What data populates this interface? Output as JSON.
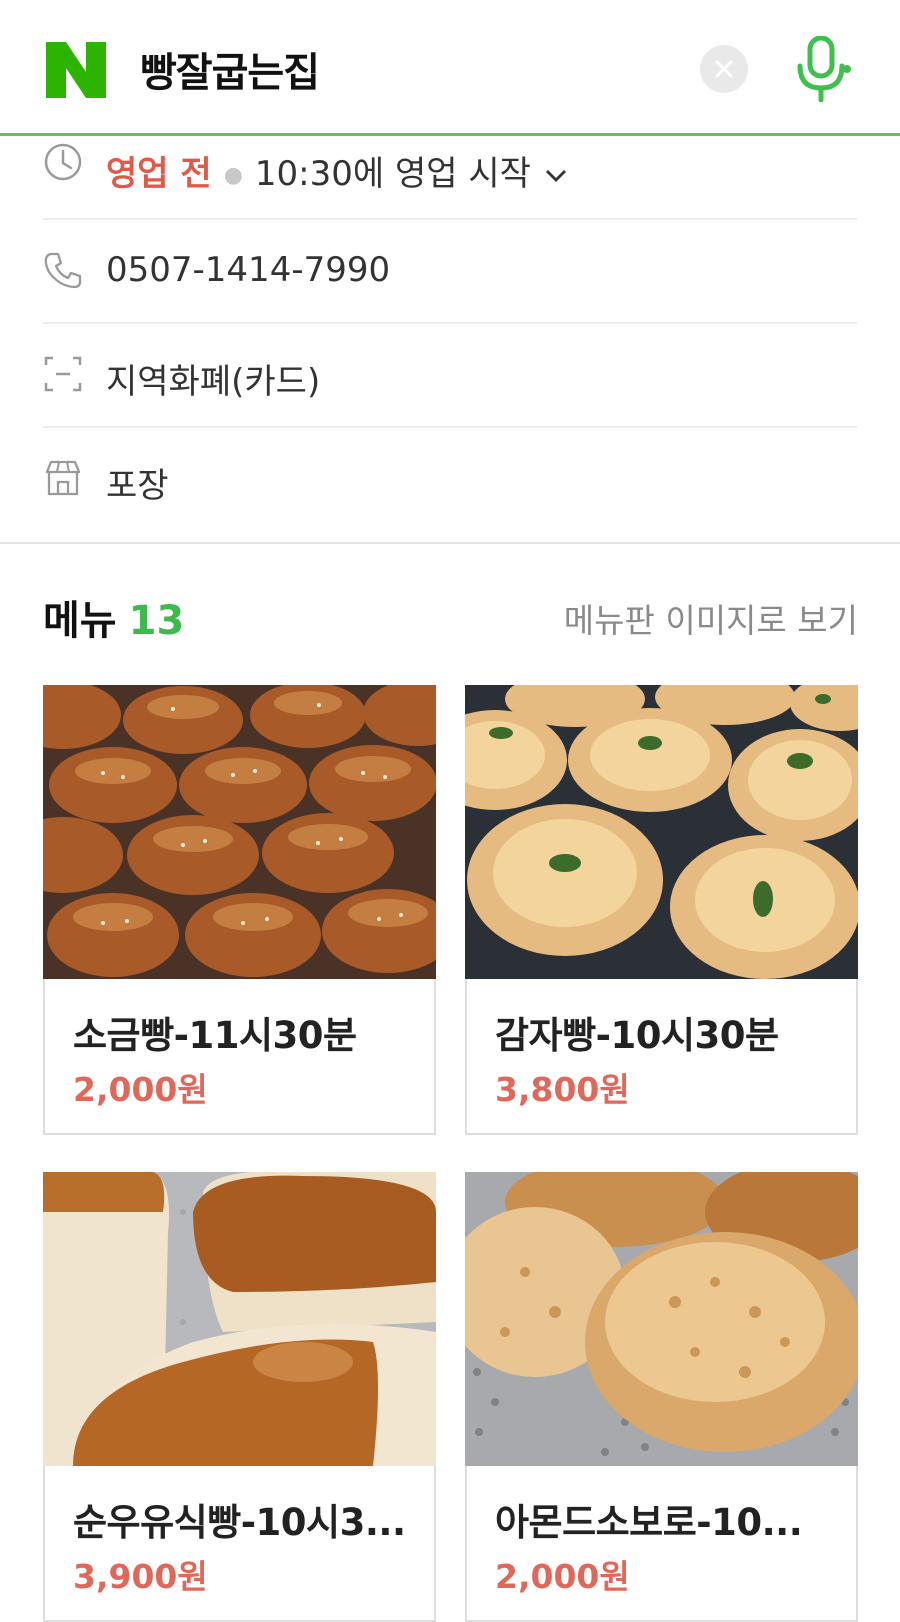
{
  "header": {
    "logo_letter": "N",
    "title": "빵잘굽는집"
  },
  "info": {
    "status": "영업 전",
    "hours": "10:30에 영업 시작",
    "phone": "0507-1414-7990",
    "payment": "지역화폐(카드)",
    "service": "포장"
  },
  "menu": {
    "title": "메뉴",
    "count": "13",
    "board_link": "메뉴판 이미지로 보기",
    "items": [
      {
        "name": "소금빵-11시30분",
        "price": "2,000원",
        "photo": "salt-bread-photo"
      },
      {
        "name": "감자빵-10시30분",
        "price": "3,800원",
        "photo": "potato-bread-photo"
      },
      {
        "name": "순우유식빵-10시3...",
        "price": "3,900원",
        "photo": "milk-bread-photo"
      },
      {
        "name": "아몬드소보로-10...",
        "price": "2,000원",
        "photo": "almond-soboro-photo"
      }
    ]
  },
  "colors": {
    "brand_green": "#5fc25c",
    "status_red": "#e05a4a",
    "price_red": "#e0685a",
    "count_green": "#3dba4e"
  }
}
